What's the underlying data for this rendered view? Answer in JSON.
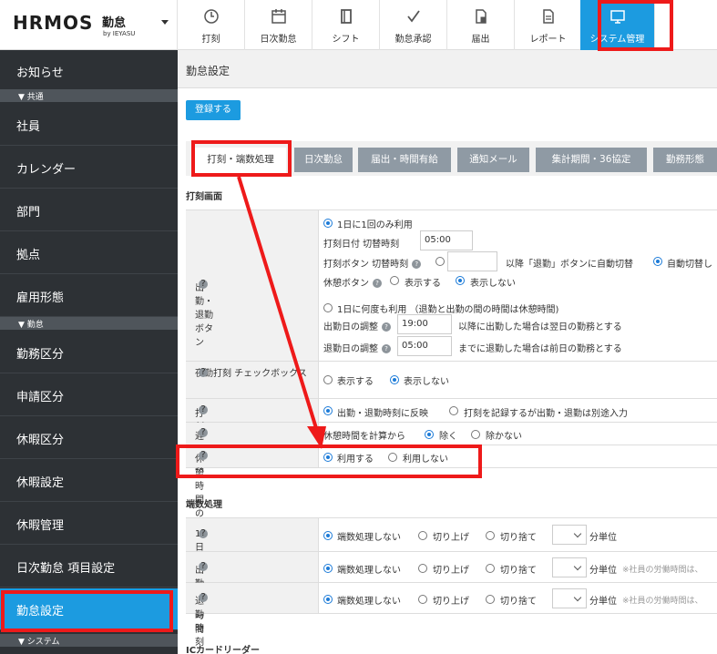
{
  "header": {
    "logo_main": "HRMOS",
    "logo_sub": "勤怠",
    "logo_by": "by IEYASU",
    "nav": [
      {
        "label": "打刻",
        "icon": "clock-icon"
      },
      {
        "label": "日次勤怠",
        "icon": "calendar-icon"
      },
      {
        "label": "シフト",
        "icon": "book-icon"
      },
      {
        "label": "勤怠承認",
        "icon": "check-icon"
      },
      {
        "label": "届出",
        "icon": "file-lock-icon"
      },
      {
        "label": "レポート",
        "icon": "document-icon"
      },
      {
        "label": "システム管理",
        "icon": "monitor-icon",
        "active": true
      }
    ]
  },
  "sidebar": {
    "items": [
      {
        "label": "お知らせ"
      },
      {
        "section": "▼ 共通"
      },
      {
        "label": "社員"
      },
      {
        "label": "カレンダー"
      },
      {
        "label": "部門"
      },
      {
        "label": "拠点"
      },
      {
        "label": "雇用形態"
      },
      {
        "section": "▼ 勤怠"
      },
      {
        "label": "勤務区分"
      },
      {
        "label": "申請区分"
      },
      {
        "label": "休暇区分"
      },
      {
        "label": "休暇設定"
      },
      {
        "label": "休暇管理"
      },
      {
        "label": "日次勤怠 項目設定"
      },
      {
        "label": "勤怠設定",
        "active": true
      },
      {
        "section": "▼ システム"
      }
    ]
  },
  "main": {
    "page_title": "勤怠設定",
    "register_button": "登録する",
    "tabs": [
      "打刻・端数処理",
      "日次勤怠",
      "届出・時間有給",
      "通知メール",
      "集計期間・36協定",
      "勤務形態"
    ],
    "stamp_section": "打刻画面",
    "stamp_rows": {
      "clock_button": {
        "label": "出勤・退勤ボタン",
        "once_option": "1日に1回のみ利用",
        "date_switch_label": "打刻日付 切替時刻",
        "date_switch_value": "05:00",
        "btn_switch_label": "打刻ボタン 切替時刻",
        "btn_switch_value": "",
        "btn_switch_after": "以降「退勤」ボタンに自動切替",
        "auto_switch_option": "自動切替し",
        "break_button_label": "休憩ボタン",
        "show": "表示する",
        "hide": "表示しない",
        "multi_option": "1日に何度も利用 （退勤と出勤の間の時間は休憩時間)",
        "in_adjust_label": "出勤日の調整",
        "in_adjust_value": "19:00",
        "in_adjust_after": "以降に出勤した場合は翌日の勤務とする",
        "out_adjust_label": "退勤日の調整",
        "out_adjust_value": "05:00",
        "out_adjust_after": "までに退勤した場合は前日の勤務とする"
      },
      "night_check": {
        "label": "夜勤打刻 チェックボックス",
        "show": "表示する",
        "hide": "表示しない"
      },
      "reflect": {
        "label": "打刻の反映",
        "opt1": "出勤・退勤時刻に反映",
        "opt2": "打刻を記録するが出勤・退勤は別途入力"
      },
      "late_early": {
        "label": "遅刻・早退",
        "text": "休憩時間を計算から",
        "opt1": "除く",
        "opt2": "除かない"
      },
      "auto_break": {
        "label": "休憩時間の自動追加",
        "opt1": "利用する",
        "opt2": "利用しない"
      }
    },
    "rounding_section": "端数処理",
    "rounding_rows": [
      {
        "label": "1日の総労働時間",
        "opt1": "端数処理しない",
        "opt2": "切り上げ",
        "opt3": "切り捨て",
        "unit": "分単位",
        "note": ""
      },
      {
        "label": "出勤時刻",
        "opt1": "端数処理しない",
        "opt2": "切り上げ",
        "opt3": "切り捨て",
        "unit": "分単位",
        "note": "※社員の労働時間は、"
      },
      {
        "label": "退勤時刻",
        "opt1": "端数処理しない",
        "opt2": "切り上げ",
        "opt3": "切り捨て",
        "unit": "分単位",
        "note": "※社員の労働時間は、"
      }
    ],
    "ic_section": "ICカードリーダー"
  },
  "colors": {
    "accent": "#1c9be0",
    "sidebar_bg": "#2d3135",
    "highlight": "#ee1a1a"
  }
}
